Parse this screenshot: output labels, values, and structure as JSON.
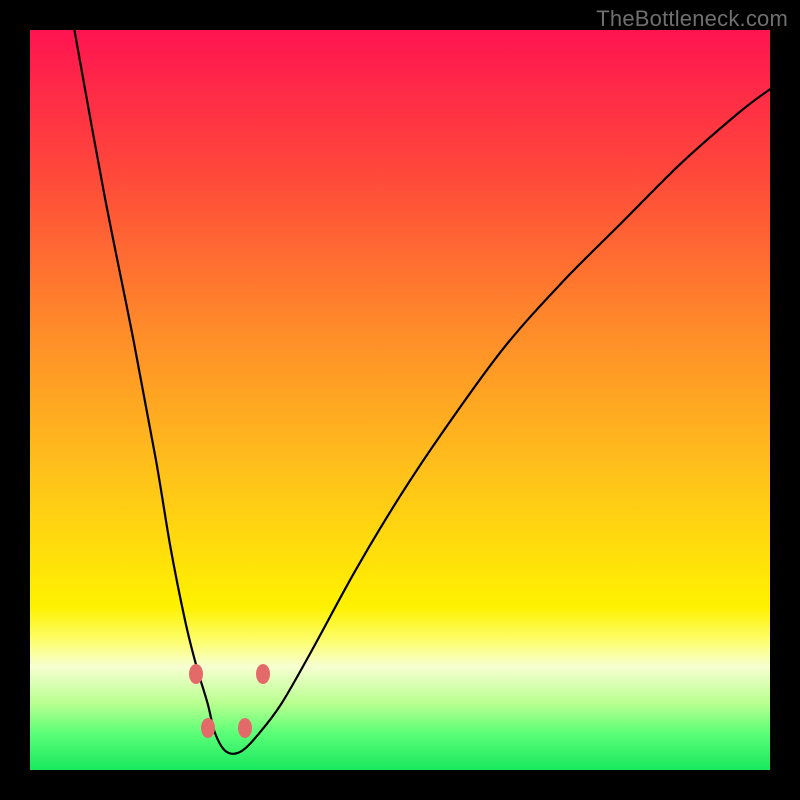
{
  "watermark": "TheBottleneck.com",
  "chart_data": {
    "type": "line",
    "title": "",
    "xlabel": "",
    "ylabel": "",
    "xlim": [
      0,
      100
    ],
    "ylim": [
      0,
      100
    ],
    "grid": false,
    "legend": false,
    "gradient_stops": [
      {
        "offset": 0.0,
        "color": "#ff1450"
      },
      {
        "offset": 0.2,
        "color": "#ff4a3a"
      },
      {
        "offset": 0.4,
        "color": "#ff8a2a"
      },
      {
        "offset": 0.6,
        "color": "#ffc21a"
      },
      {
        "offset": 0.78,
        "color": "#fff200"
      },
      {
        "offset": 0.83,
        "color": "#fdff7a"
      },
      {
        "offset": 0.86,
        "color": "#f7ffd2"
      },
      {
        "offset": 0.91,
        "color": "#b8ff8f"
      },
      {
        "offset": 0.95,
        "color": "#5cff78"
      },
      {
        "offset": 1.0,
        "color": "#18e85e"
      }
    ],
    "series": [
      {
        "name": "bottleneck-curve",
        "x": [
          6,
          10,
          14,
          17,
          19,
          21,
          22.5,
          24,
          25,
          26.5,
          28.5,
          31,
          34,
          38,
          44,
          50,
          56,
          64,
          72,
          80,
          88,
          96,
          100
        ],
        "values": [
          100,
          78,
          58,
          42,
          30,
          20,
          14,
          9,
          5,
          2.5,
          2.5,
          5,
          9,
          16,
          27,
          37,
          46,
          57,
          66,
          74,
          82,
          89,
          92
        ]
      }
    ],
    "markers": [
      {
        "x": 22.4,
        "y": 13.0
      },
      {
        "x": 24.0,
        "y": 5.7
      },
      {
        "x": 29.0,
        "y": 5.7
      },
      {
        "x": 31.5,
        "y": 13.0
      }
    ]
  }
}
